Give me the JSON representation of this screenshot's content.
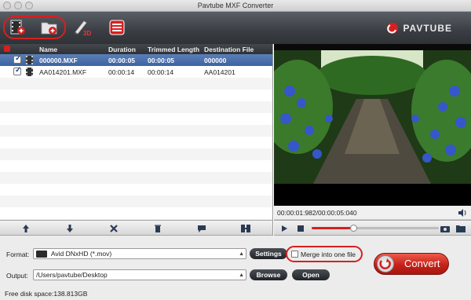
{
  "window": {
    "title": "Pavtube MXF Converter"
  },
  "toolbar": {
    "buttons": [
      {
        "name": "add-video-icon"
      },
      {
        "name": "add-folder-icon"
      },
      {
        "name": "edit-3d-icon"
      },
      {
        "name": "task-list-icon"
      }
    ],
    "brand": "PAVTUBE",
    "accent": "#d62020"
  },
  "file_list": {
    "columns": [
      "Name",
      "Duration",
      "Trimmed Length",
      "Destination File"
    ],
    "rows": [
      {
        "name": "000000.MXF",
        "duration": "00:00:05",
        "trimmed": "00:00:05",
        "dest": "000000",
        "checked": true,
        "selected": true
      },
      {
        "name": "AA014201.MXF",
        "duration": "00:00:14",
        "trimmed": "00:00:14",
        "dest": "AA014201",
        "checked": true,
        "selected": false
      }
    ]
  },
  "list_tools": [
    "move-up-icon",
    "move-down-icon",
    "remove-icon",
    "trash-icon",
    "comment-icon",
    "merge-icon"
  ],
  "preview": {
    "timecode": "00:00:01:982/00:00:05:040",
    "progress": 0.33
  },
  "format": {
    "label": "Format:",
    "value": "Avid DNxHD (*.mov)",
    "settings_label": "Settings",
    "merge_label": "Merge into one file"
  },
  "output": {
    "label": "Output:",
    "value": "/Users/pavtube/Desktop",
    "browse_label": "Browse",
    "open_label": "Open"
  },
  "convert_label": "Convert",
  "disk": {
    "text": "Free disk space:138.813GB"
  }
}
